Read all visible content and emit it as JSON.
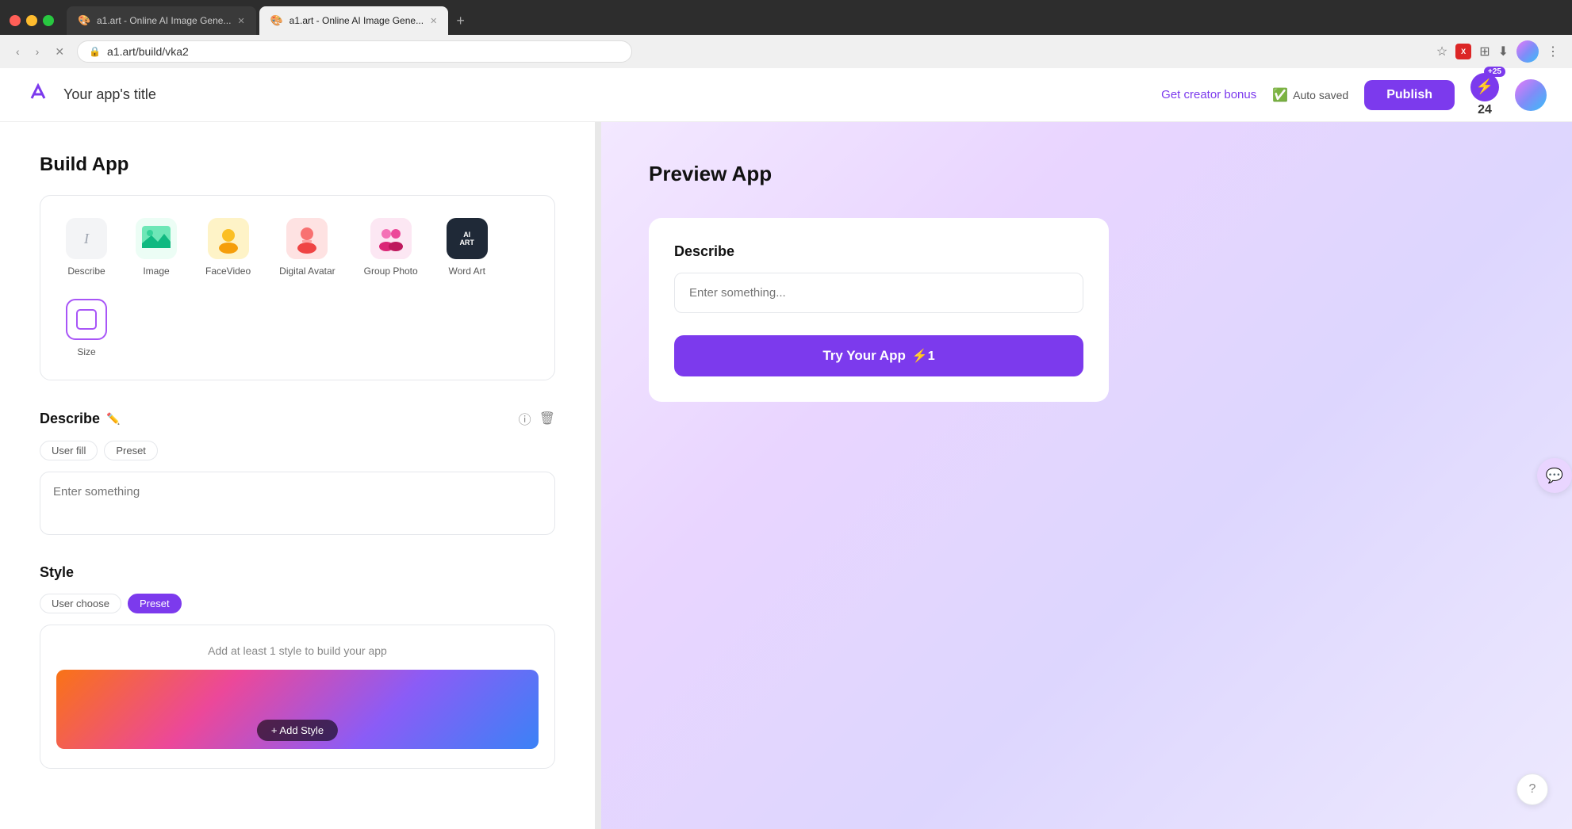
{
  "browser": {
    "tabs": [
      {
        "label": "a1.art - Online AI Image Gene...",
        "active": false,
        "favicon": "🎨"
      },
      {
        "label": "a1.art - Online AI Image Gene...",
        "active": true,
        "favicon": "🎨"
      }
    ],
    "url": "a1.art/build/vka2",
    "add_tab_label": "+"
  },
  "header": {
    "logo": "a",
    "app_title": "Your app's title",
    "get_bonus_label": "Get creator bonus",
    "auto_saved_label": "Auto saved",
    "publish_label": "Publish",
    "plus_badge": "+25",
    "credits": "24"
  },
  "build": {
    "section_title": "Build App",
    "tools": [
      {
        "name": "Describe",
        "icon": "I",
        "type": "describe"
      },
      {
        "name": "Image",
        "icon": "🖼️",
        "type": "image"
      },
      {
        "name": "FaceVideo",
        "icon": "👤",
        "type": "facevideo"
      },
      {
        "name": "Digital Avatar",
        "icon": "🧑‍💻",
        "type": "digital"
      },
      {
        "name": "Group Photo",
        "icon": "👥",
        "type": "groupphoto"
      },
      {
        "name": "Word Art",
        "icon": "AI ART",
        "type": "wordart"
      },
      {
        "name": "Size",
        "icon": "⬜",
        "type": "size"
      }
    ],
    "describe": {
      "title": "Describe",
      "tags": [
        {
          "label": "User fill",
          "active": false
        },
        {
          "label": "Preset",
          "active": false
        }
      ],
      "placeholder": "Enter something"
    },
    "style": {
      "title": "Style",
      "tags": [
        {
          "label": "User choose",
          "active": false
        },
        {
          "label": "Preset",
          "active": true
        }
      ],
      "add_hint": "Add at least 1 style to build your app",
      "add_btn_label": "+ Add Style"
    }
  },
  "preview": {
    "section_title": "Preview App",
    "describe_label": "Describe",
    "input_placeholder": "Enter something...",
    "try_btn_label": "Try Your App",
    "try_btn_cost": "⚡1"
  }
}
